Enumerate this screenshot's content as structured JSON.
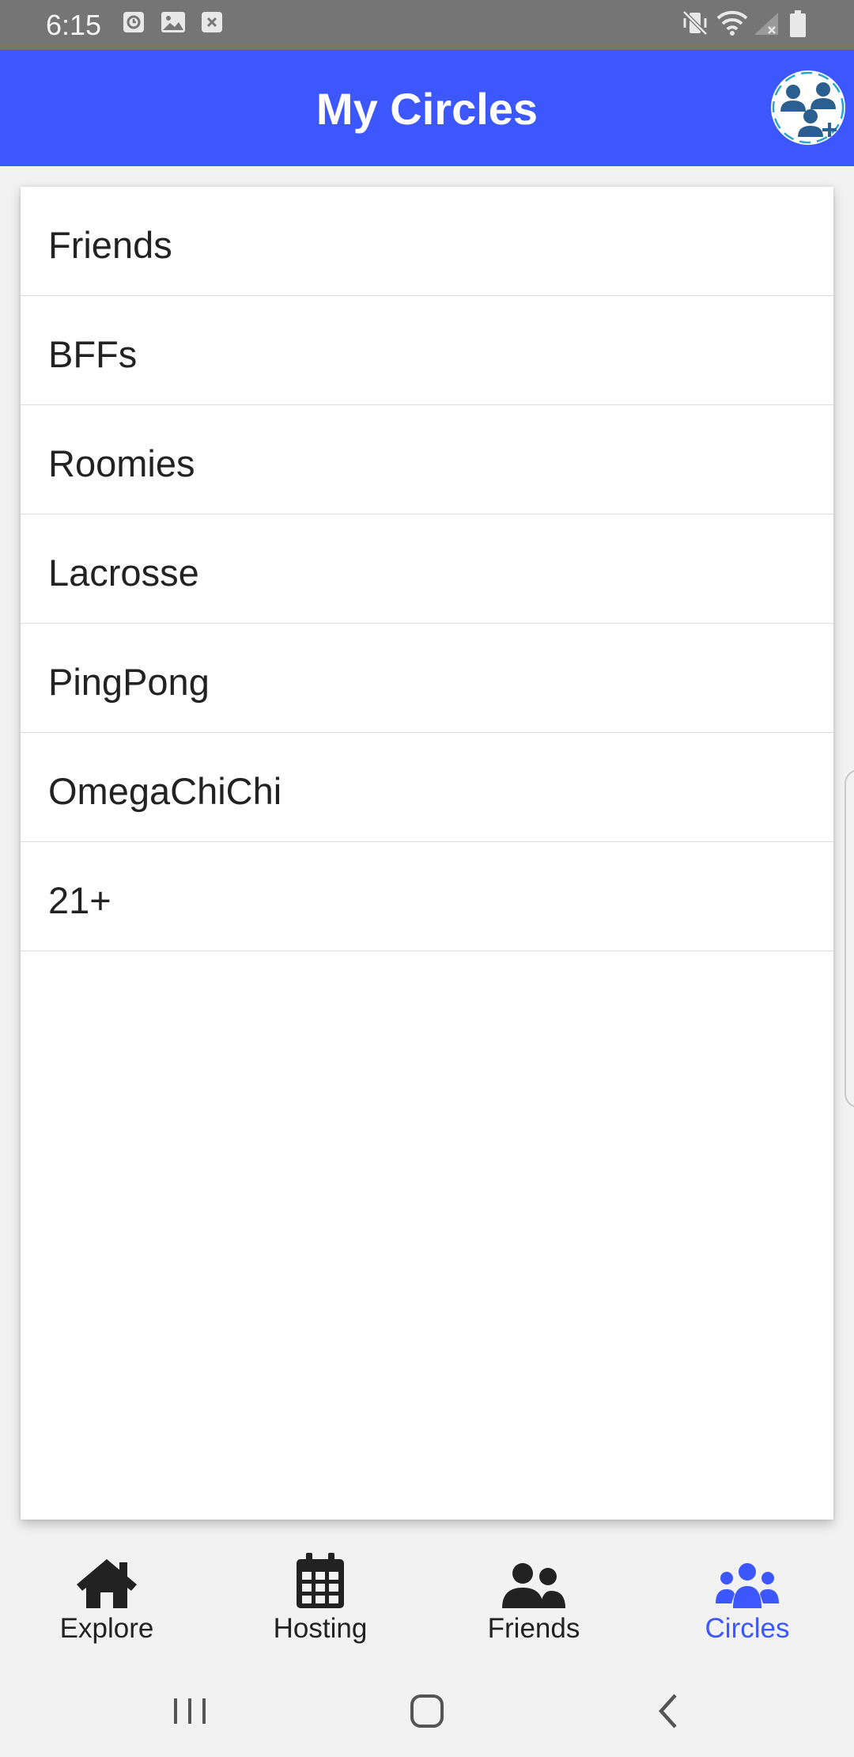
{
  "status_bar": {
    "time": "6:15",
    "icons_left": [
      "clock-notification-icon",
      "image-notification-icon",
      "close-box-notification-icon"
    ],
    "icons_right": [
      "vibrate-mute-icon",
      "wifi-icon",
      "no-signal-icon",
      "battery-icon"
    ]
  },
  "header": {
    "title": "My Circles",
    "background": "#3d57fe",
    "avatar_icon": "circle-group-avatar-icon"
  },
  "circles": [
    {
      "label": "Friends"
    },
    {
      "label": "BFFs"
    },
    {
      "label": "Roomies"
    },
    {
      "label": "Lacrosse"
    },
    {
      "label": "PingPong"
    },
    {
      "label": "OmegaChiChi"
    },
    {
      "label": "21+"
    }
  ],
  "bottom_nav": {
    "active_color": "#3d57fe",
    "inactive_color": "#222222",
    "items": [
      {
        "label": "Explore",
        "icon": "home-icon",
        "active": false
      },
      {
        "label": "Hosting",
        "icon": "calendar-icon",
        "active": false
      },
      {
        "label": "Friends",
        "icon": "users-icon",
        "active": false
      },
      {
        "label": "Circles",
        "icon": "users-group-icon",
        "active": true
      }
    ]
  },
  "system_nav": {
    "buttons": [
      "recent-apps-icon",
      "home-button-icon",
      "back-icon"
    ]
  }
}
